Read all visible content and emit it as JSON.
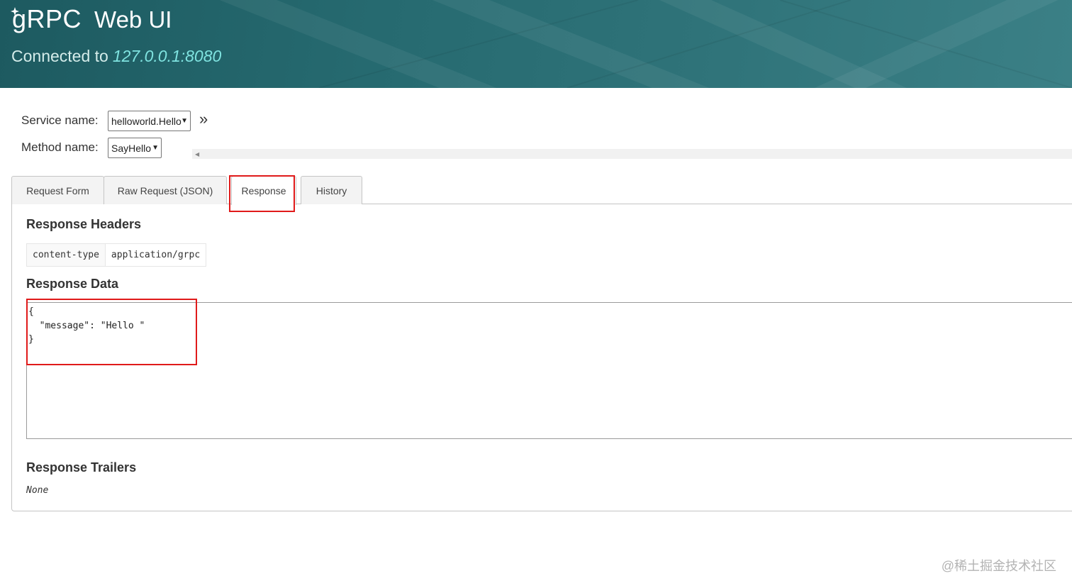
{
  "header": {
    "logo": "gRPC",
    "title": "Web UI",
    "connected_label": "Connected to",
    "address": "127.0.0.1:8080"
  },
  "selectors": {
    "service_label": "Service name:",
    "service_value": "helloworld.Hello",
    "method_label": "Method name:",
    "method_value": "SayHello",
    "expand_icon": "»"
  },
  "tabs": [
    {
      "label": "Request Form"
    },
    {
      "label": "Raw Request (JSON)"
    },
    {
      "label": "Response"
    },
    {
      "label": "History"
    }
  ],
  "active_tab": "Response",
  "response": {
    "headers_title": "Response Headers",
    "headers": [
      {
        "key": "content-type",
        "value": "application/grpc"
      }
    ],
    "data_title": "Response Data",
    "data_text": "{\n  \"message\": \"Hello \"\n}",
    "trailers_title": "Response Trailers",
    "trailers_value": "None"
  },
  "watermark": "@稀土掘金技术社区",
  "colors": {
    "header_bg": "#266a70",
    "address": "#7fe3e0",
    "highlight": "#e01a1a"
  }
}
